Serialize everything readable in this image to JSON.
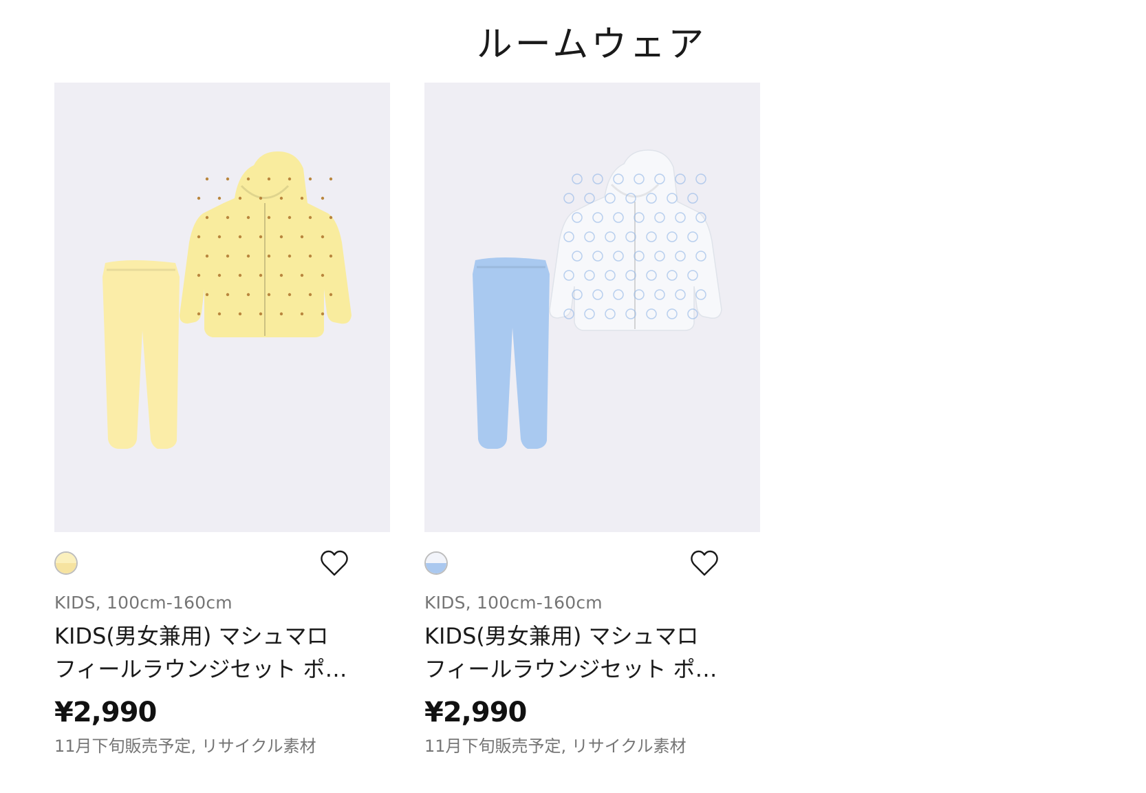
{
  "section": {
    "title": "ルームウェア"
  },
  "products": [
    {
      "image_alt": "pikachu-loungeset-image",
      "colors": {
        "hood": "#f9ec9e",
        "pants": "#fbeda8",
        "print": "#b9863e"
      },
      "swatch": {
        "top": "#fbf0bd",
        "bottom": "#f6e3a0"
      },
      "meta": "KIDS, 100cm-160cm",
      "name": "KIDS(男女兼用) マシュマロフィールラウンジセット ポ…",
      "price": "¥2,990",
      "notes": "11月下旬販売予定, リサイクル素材",
      "favorite_icon": "heart-outline-icon"
    },
    {
      "image_alt": "blue-loungeset-image",
      "colors": {
        "hood": "#f7f8fb",
        "pants": "#a9c9f0",
        "print": "#8db4e6"
      },
      "swatch": {
        "top": "#f2f4fa",
        "bottom": "#aac8ef"
      },
      "meta": "KIDS, 100cm-160cm",
      "name": "KIDS(男女兼用) マシュマロフィールラウンジセット ポ…",
      "price": "¥2,990",
      "notes": "11月下旬販売予定, リサイクル素材",
      "favorite_icon": "heart-outline-icon"
    }
  ]
}
